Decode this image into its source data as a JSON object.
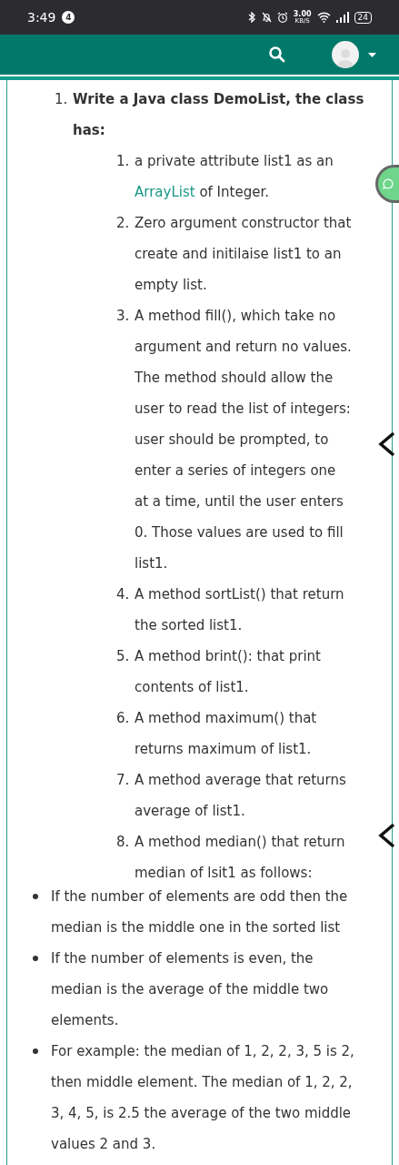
{
  "status_bar": {
    "time": "3:49",
    "notification_count": "4",
    "speed_value": "3.00",
    "speed_unit": "KB/S",
    "battery": "24"
  },
  "question": {
    "number": "1.",
    "title": "Write a Java class DemoList, the class has:",
    "items": [
      {
        "number": "1.",
        "segments": [
          {
            "kind": "plain",
            "text": "a private attribute list1 as an "
          },
          {
            "kind": "link",
            "text": "ArrayList"
          },
          {
            "kind": "plain",
            "text": " of Integer."
          }
        ]
      },
      {
        "number": "2.",
        "segments": [
          {
            "kind": "plain",
            "text": "Zero argument constructor that create and initilaise list1 to an empty list."
          }
        ]
      },
      {
        "number": "3.",
        "segments": [
          {
            "kind": "plain",
            "text": "A method fill(), which take no argument and return no values. The method should allow the user to read the list of integers: user should be prompted, to enter a series of integers one at a time, until the user enters 0. Those values are used to fill  list1."
          }
        ]
      },
      {
        "number": "4.",
        "segments": [
          {
            "kind": "plain",
            "text": "A method sortList() that return the sorted list1."
          }
        ]
      },
      {
        "number": "5.",
        "segments": [
          {
            "kind": "plain",
            "text": "A method brint(): that print contents of list1."
          }
        ]
      },
      {
        "number": "6.",
        "segments": [
          {
            "kind": "plain",
            "text": "A method maximum() that returns maximum of list1."
          }
        ]
      },
      {
        "number": "7.",
        "segments": [
          {
            "kind": "plain",
            "text": "A method average that returns average of list1."
          }
        ]
      },
      {
        "number": "8.",
        "segments": [
          {
            "kind": "plain",
            "text": "A method median() that return median of lsit1 as follows:"
          }
        ]
      }
    ],
    "bullets": [
      "If the number of elements are odd then the median is the middle one in the sorted list",
      "If the number of elements is even, the median is the average of the middle two elements.",
      "For example: the median of 1, 2, 2, 3, 5 is 2, then middle element. The median of 1, 2, 2, 3, 4, 5, is 2.5 the average of the two middle values 2 and 3."
    ]
  }
}
